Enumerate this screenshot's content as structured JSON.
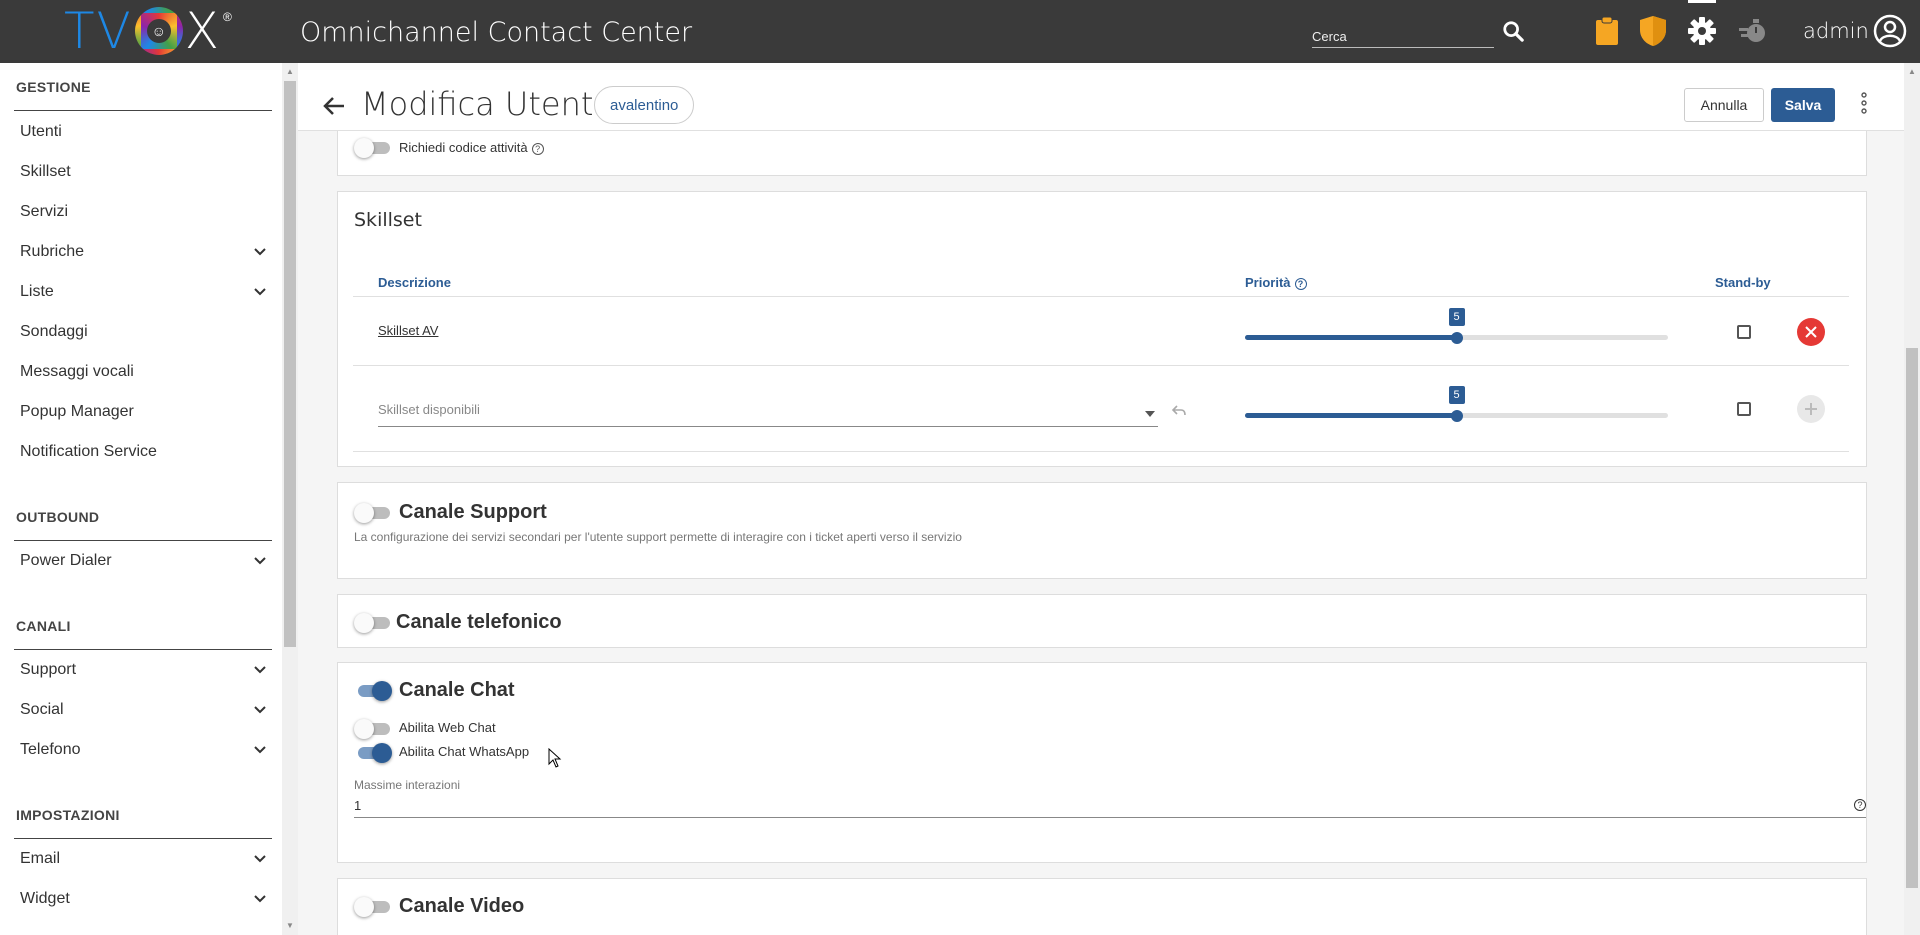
{
  "app": {
    "logo_text_left": "TV",
    "logo_text_right": "X",
    "logo_registered": "®",
    "title": "Omnichannel Contact Center",
    "user": "admin"
  },
  "search": {
    "placeholder": "Cerca"
  },
  "colors": {
    "topbar": "#3a3a3a",
    "accent": "#2c5c94",
    "danger": "#e53935",
    "badge_orange": "#f5a623"
  },
  "sidebar": {
    "sections": [
      {
        "title": "GESTIONE",
        "items": [
          {
            "label": "Utenti",
            "expandable": false
          },
          {
            "label": "Skillset",
            "expandable": false
          },
          {
            "label": "Servizi",
            "expandable": false
          },
          {
            "label": "Rubriche",
            "expandable": true
          },
          {
            "label": "Liste",
            "expandable": true
          },
          {
            "label": "Sondaggi",
            "expandable": false
          },
          {
            "label": "Messaggi vocali",
            "expandable": false
          },
          {
            "label": "Popup Manager",
            "expandable": false
          },
          {
            "label": "Notification Service",
            "expandable": false
          }
        ]
      },
      {
        "title": "OUTBOUND",
        "items": [
          {
            "label": "Power Dialer",
            "expandable": true
          }
        ]
      },
      {
        "title": "CANALI",
        "items": [
          {
            "label": "Support",
            "expandable": true
          },
          {
            "label": "Social",
            "expandable": true
          },
          {
            "label": "Telefono",
            "expandable": true
          }
        ]
      },
      {
        "title": "IMPOSTAZIONI",
        "items": [
          {
            "label": "Email",
            "expandable": true
          },
          {
            "label": "Widget",
            "expandable": true
          }
        ]
      }
    ]
  },
  "header": {
    "title": "Modifica Utente",
    "username": "avalentino",
    "cancel_label": "Annulla",
    "save_label": "Salva"
  },
  "activity_code": {
    "label": "Richiedi codice attività",
    "enabled": false
  },
  "skillset": {
    "title": "Skillset",
    "col_description": "Descrizione",
    "col_priority": "Priorità",
    "col_standby": "Stand-by",
    "rows": [
      {
        "name": "Skillset AV",
        "priority": 5,
        "priority_max": 10,
        "standby": false
      }
    ],
    "new_row": {
      "placeholder": "Skillset disponibili",
      "priority": 5,
      "priority_max": 10,
      "standby": false
    }
  },
  "canale_support": {
    "title": "Canale Support",
    "enabled": false,
    "description": "La configurazione dei servizi secondari per l'utente support permette di interagire con i ticket aperti verso il servizio"
  },
  "canale_telefonico": {
    "title": "Canale telefonico",
    "enabled": false
  },
  "canale_chat": {
    "title": "Canale Chat",
    "enabled": true,
    "web_chat_label": "Abilita Web Chat",
    "web_chat_enabled": false,
    "whatsapp_label": "Abilita Chat WhatsApp",
    "whatsapp_enabled": true,
    "max_interactions_label": "Massime interazioni",
    "max_interactions_value": "1"
  },
  "canale_video": {
    "title": "Canale Video",
    "enabled": false
  }
}
